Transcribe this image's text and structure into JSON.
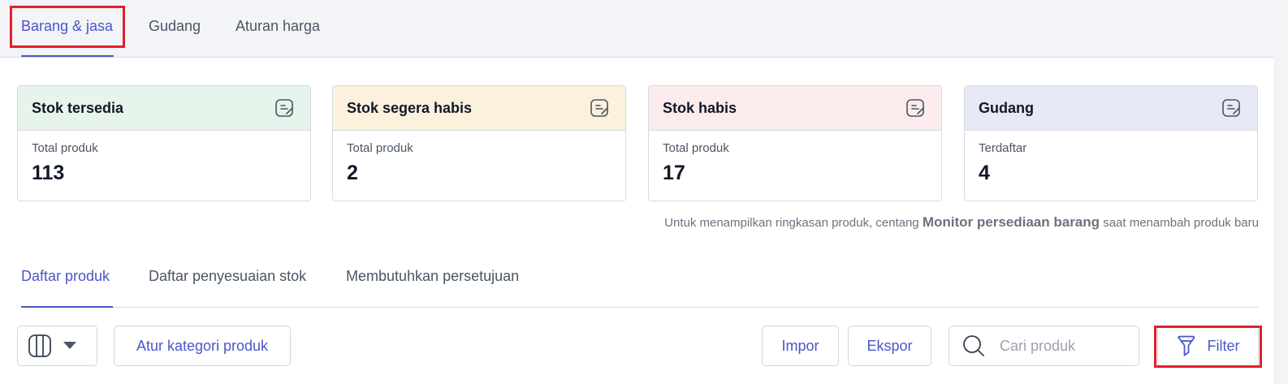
{
  "top_tabs": [
    {
      "label": "Barang & jasa",
      "active": true
    },
    {
      "label": "Gudang",
      "active": false
    },
    {
      "label": "Aturan harga",
      "active": false
    }
  ],
  "cards": [
    {
      "title": "Stok tersedia",
      "sub": "Total produk",
      "value": "113",
      "color": "#e7f4ec"
    },
    {
      "title": "Stok segera habis",
      "sub": "Total produk",
      "value": "2",
      "color": "#fbf1dd"
    },
    {
      "title": "Stok habis",
      "sub": "Total produk",
      "value": "17",
      "color": "#fcebed"
    },
    {
      "title": "Gudang",
      "sub": "Terdaftar",
      "value": "4",
      "color": "#e7e9f9"
    }
  ],
  "hint": {
    "prefix": "Untuk menampilkan ringkasan produk, centang",
    "emphasis": "Monitor persediaan barang",
    "suffix": "saat menambah produk baru"
  },
  "sub_tabs": [
    {
      "label": "Daftar produk",
      "active": true
    },
    {
      "label": "Daftar penyesuaian stok",
      "active": false
    },
    {
      "label": "Membutuhkan persetujuan",
      "active": false
    }
  ],
  "toolbar": {
    "column_toggle_icon": "columns-icon",
    "category_button": "Atur kategori produk",
    "import_button": "Impor",
    "export_button": "Ekspor",
    "search_placeholder": "Cari produk",
    "filter_button": "Filter"
  },
  "colors": {
    "accent": "#4a56c7",
    "highlight": "#e3202a"
  }
}
